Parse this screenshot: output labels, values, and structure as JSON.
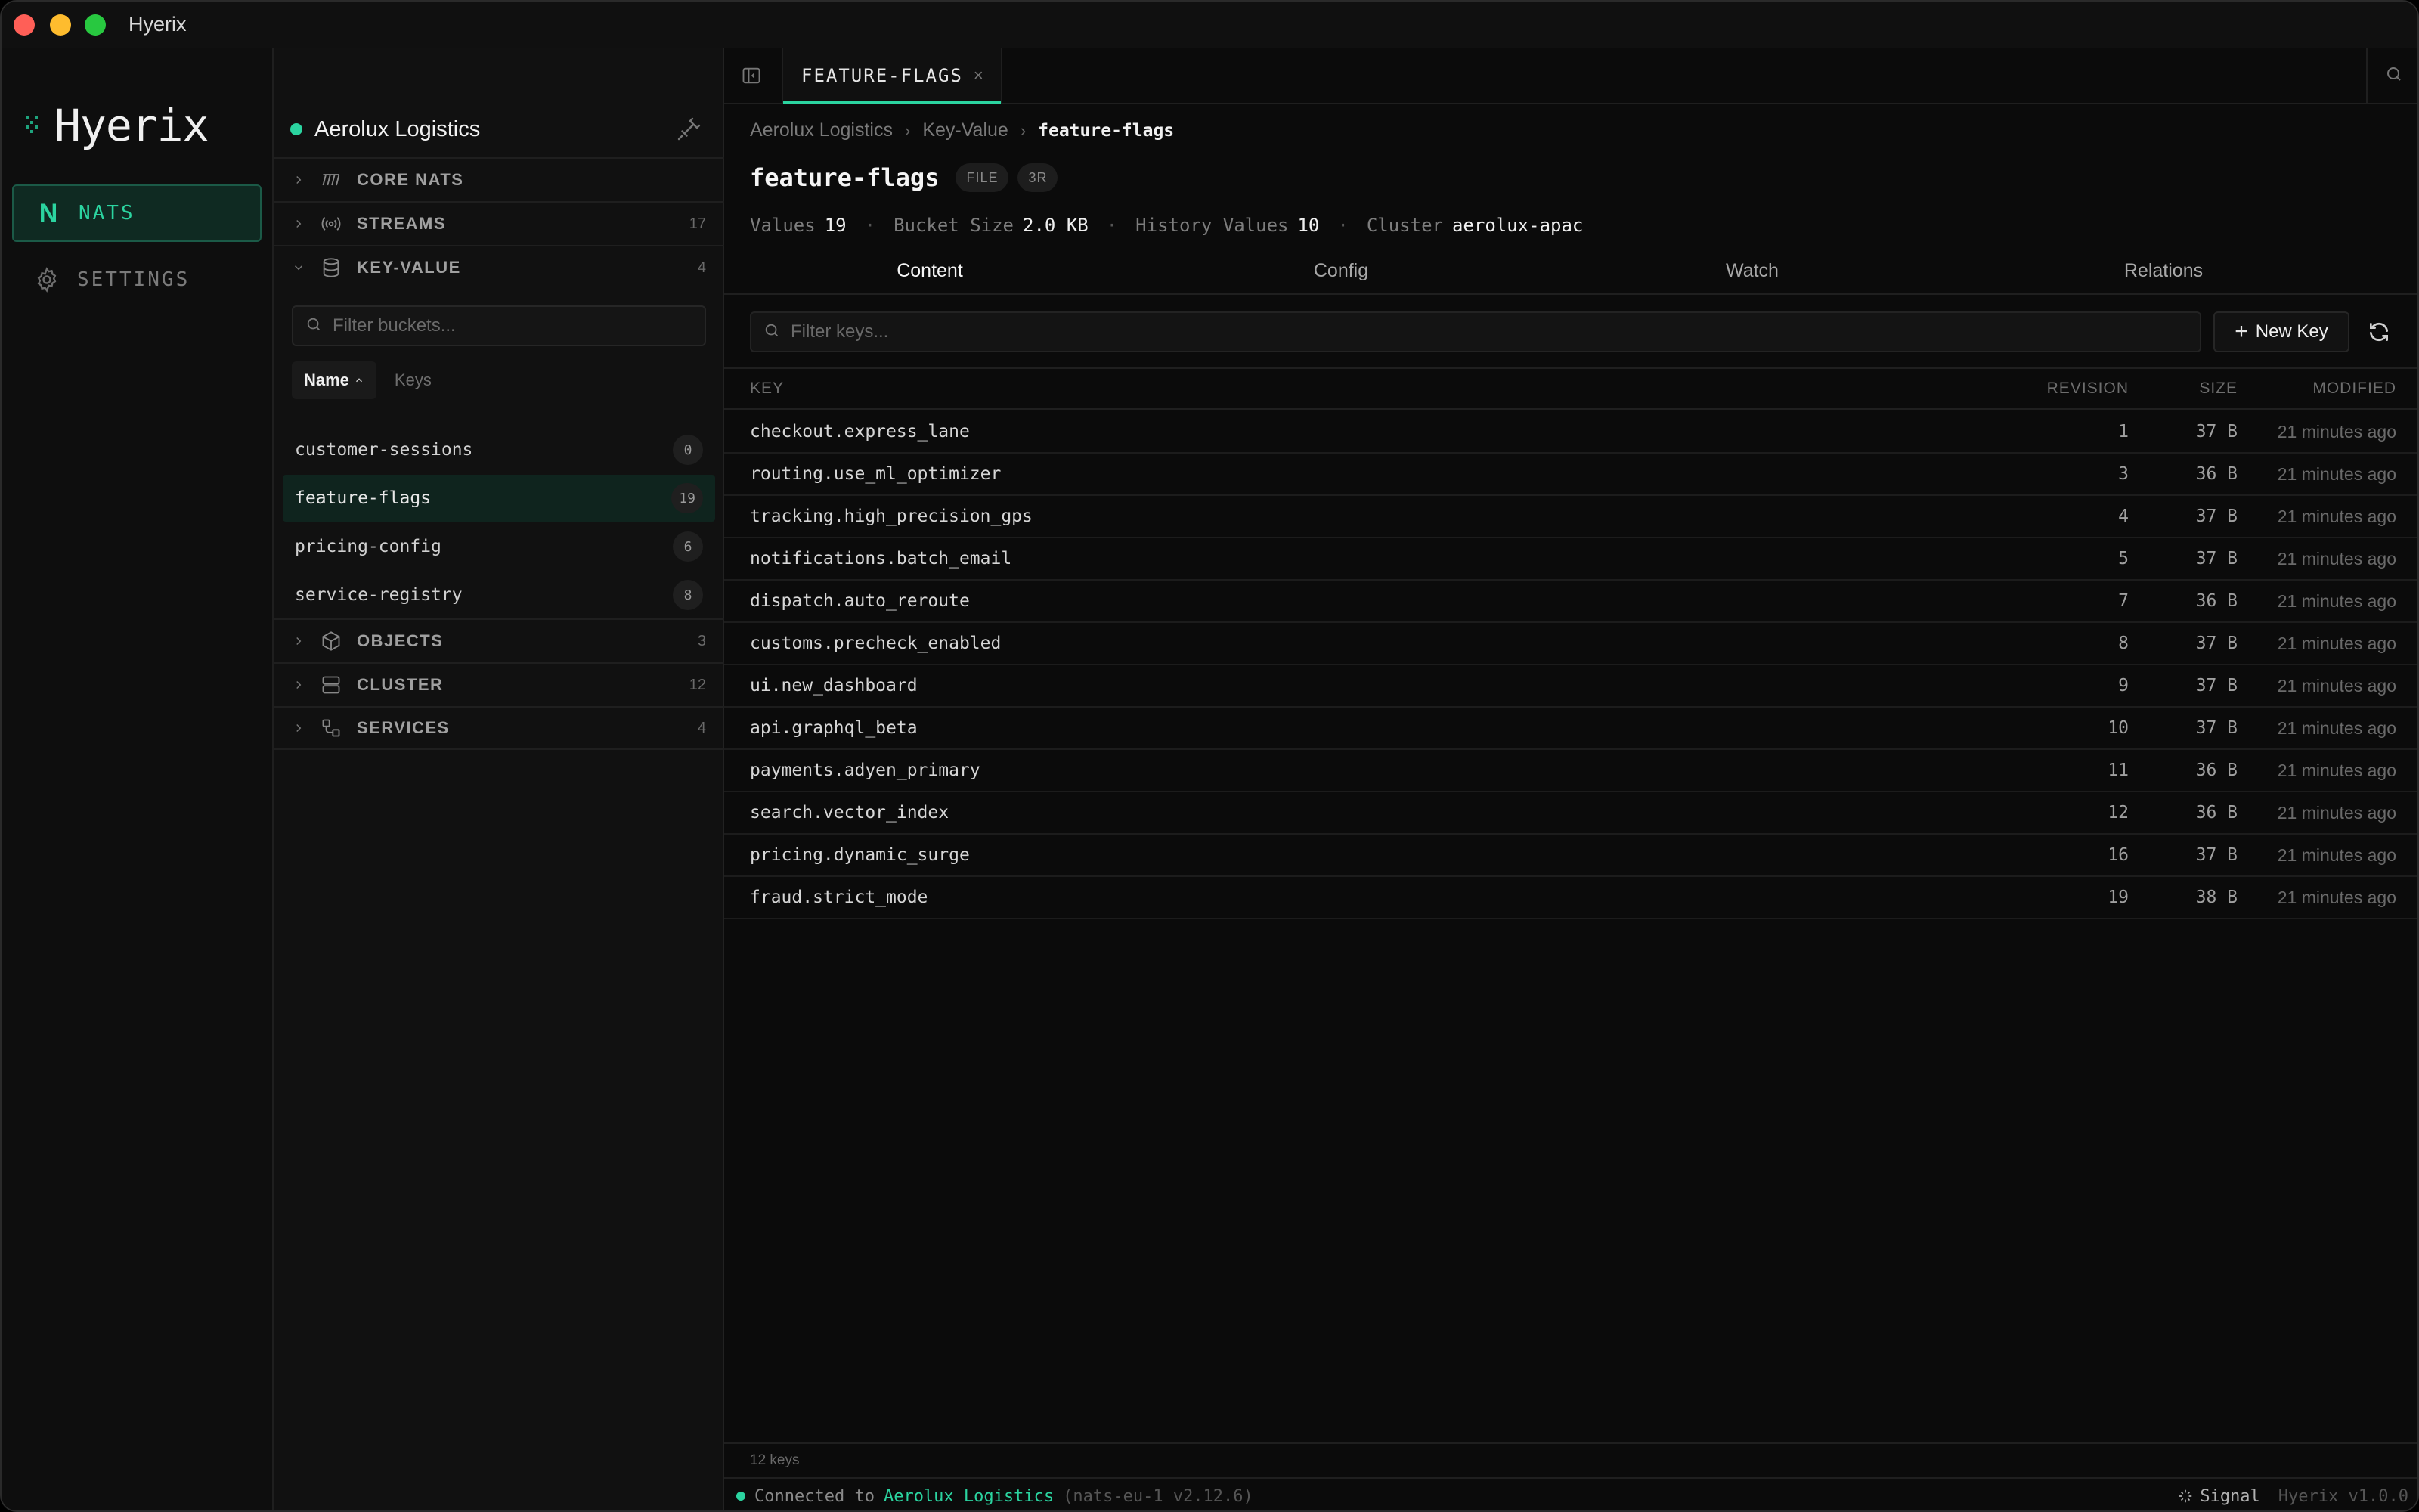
{
  "window": {
    "title": "Hyerix"
  },
  "rail": {
    "logo": "Hyerix",
    "items": [
      {
        "label": "NATS",
        "icon": "nats-n-icon",
        "active": true
      },
      {
        "label": "SETTINGS",
        "icon": "gear-icon",
        "active": false
      }
    ]
  },
  "sidebar": {
    "connection": "Aerolux Logistics",
    "sections": [
      {
        "label": "CORE NATS",
        "icon": "core-nats-icon",
        "count": ""
      },
      {
        "label": "STREAMS",
        "icon": "streams-icon",
        "count": "17"
      },
      {
        "label": "KEY-VALUE",
        "icon": "database-icon",
        "count": "4",
        "expanded": true
      },
      {
        "label": "OBJECTS",
        "icon": "cube-icon",
        "count": "3"
      },
      {
        "label": "CLUSTER",
        "icon": "server-icon",
        "count": "12"
      },
      {
        "label": "SERVICES",
        "icon": "services-icon",
        "count": "4"
      }
    ],
    "bucket_filter_placeholder": "Filter buckets...",
    "sort": {
      "name": "Name",
      "keys": "Keys"
    },
    "buckets": [
      {
        "name": "customer-sessions",
        "count": "0"
      },
      {
        "name": "feature-flags",
        "count": "19",
        "selected": true
      },
      {
        "name": "pricing-config",
        "count": "6"
      },
      {
        "name": "service-registry",
        "count": "8"
      }
    ]
  },
  "main": {
    "tab": {
      "label": "FEATURE-FLAGS",
      "close": "×"
    },
    "breadcrumb": [
      "Aerolux Logistics",
      "Key-Value",
      "feature-flags"
    ],
    "title": "feature-flags",
    "pills": [
      "FILE",
      "3R"
    ],
    "stats": [
      {
        "label": "Values",
        "value": "19"
      },
      {
        "label": "Bucket Size",
        "value": "2.0 KB"
      },
      {
        "label": "History Values",
        "value": "10"
      },
      {
        "label": "Cluster",
        "value": "aerolux-apac"
      }
    ],
    "subtabs": [
      "Content",
      "Config",
      "Watch",
      "Relations"
    ],
    "key_filter_placeholder": "Filter keys...",
    "new_key_label": "New Key",
    "columns": {
      "key": "KEY",
      "revision": "REVISION",
      "size": "SIZE",
      "modified": "MODIFIED"
    },
    "rows": [
      {
        "key": "checkout.express_lane",
        "revision": "1",
        "size": "37 B",
        "modified": "21 minutes ago"
      },
      {
        "key": "routing.use_ml_optimizer",
        "revision": "3",
        "size": "36 B",
        "modified": "21 minutes ago"
      },
      {
        "key": "tracking.high_precision_gps",
        "revision": "4",
        "size": "37 B",
        "modified": "21 minutes ago"
      },
      {
        "key": "notifications.batch_email",
        "revision": "5",
        "size": "37 B",
        "modified": "21 minutes ago"
      },
      {
        "key": "dispatch.auto_reroute",
        "revision": "7",
        "size": "36 B",
        "modified": "21 minutes ago"
      },
      {
        "key": "customs.precheck_enabled",
        "revision": "8",
        "size": "37 B",
        "modified": "21 minutes ago"
      },
      {
        "key": "ui.new_dashboard",
        "revision": "9",
        "size": "37 B",
        "modified": "21 minutes ago"
      },
      {
        "key": "api.graphql_beta",
        "revision": "10",
        "size": "37 B",
        "modified": "21 minutes ago"
      },
      {
        "key": "payments.adyen_primary",
        "revision": "11",
        "size": "36 B",
        "modified": "21 minutes ago"
      },
      {
        "key": "search.vector_index",
        "revision": "12",
        "size": "36 B",
        "modified": "21 minutes ago"
      },
      {
        "key": "pricing.dynamic_surge",
        "revision": "16",
        "size": "37 B",
        "modified": "21 minutes ago"
      },
      {
        "key": "fraud.strict_mode",
        "revision": "19",
        "size": "38 B",
        "modified": "21 minutes ago"
      }
    ],
    "footer_count": "12 keys"
  },
  "statusbar": {
    "prefix": "Connected to",
    "name": "Aerolux Logistics",
    "server": "(nats-eu-1 v2.12.6)",
    "signal": "Signal",
    "app_version": "Hyerix v1.0.0"
  },
  "colors": {
    "accent": "#2bd4a0",
    "background": "#0b0b0b",
    "selected_bg": "#0f241e"
  }
}
